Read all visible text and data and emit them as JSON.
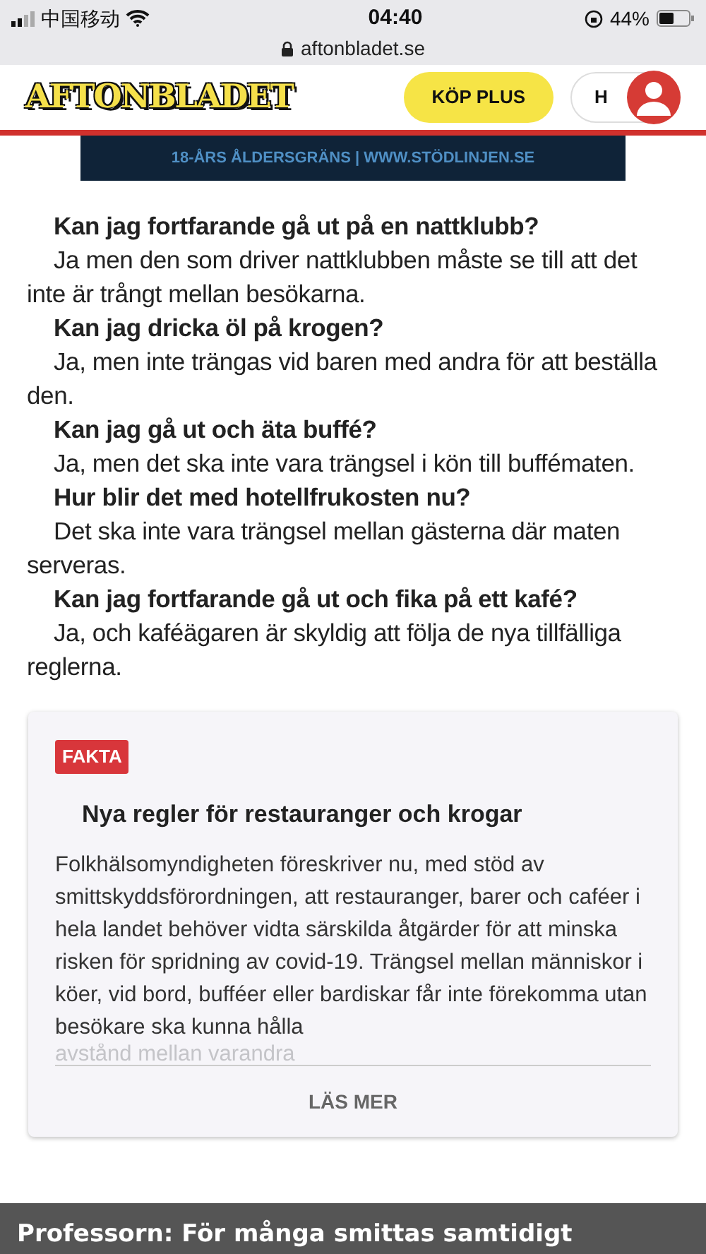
{
  "status_bar": {
    "carrier": "中国移动",
    "time": "04:40",
    "battery": "44%",
    "url": "aftonbladet.se"
  },
  "header": {
    "logo": "AFTONBLADET",
    "buy_button": "KÖP PLUS",
    "account_initial": "H"
  },
  "banner": "18-ÅRS ÅLDERSGRÄNS | WWW.STÖDLINJEN.SE",
  "qa": [
    {
      "question": "Kan jag fortfarande gå ut på en nattklubb?",
      "answer": "Ja men den som driver nattklubben måste se till att det inte är trångt mellan besökarna."
    },
    {
      "question": "Kan jag dricka öl på krogen?",
      "answer": "Ja, men inte trängas vid baren med andra för att beställa den."
    },
    {
      "question": "Kan jag gå ut och äta buffé?",
      "answer": "Ja, men det ska inte vara trängsel i kön till buffématen."
    },
    {
      "question": "Hur blir det med hotellfrukosten nu?",
      "answer": "Det ska inte vara trängsel mellan gästerna där maten serveras."
    },
    {
      "question": "Kan jag fortfarande gå ut och fika på ett kafé?",
      "answer": "Ja, och kaféägaren är skyldig att följa de nya tillfälliga reglerna."
    }
  ],
  "fact_card": {
    "badge": "FAKTA",
    "title": "Nya regler för restauranger och krogar",
    "body": "Folkhälsomyndigheten föreskriver nu, med stöd av smittskyddsförordningen, att restauranger, barer och caféer i hela landet behöver vidta särskilda åtgärder för att minska risken för spridning av covid-19. Trängsel mellan människor i köer, vid bord, bufféer eller bardiskar får inte förekomma utan besökare ska kunna hålla",
    "faded_line": "avstånd mellan varandra",
    "button": "LÄS MER"
  },
  "bottom_bar": "Professorn: För många smittas samtidigt"
}
